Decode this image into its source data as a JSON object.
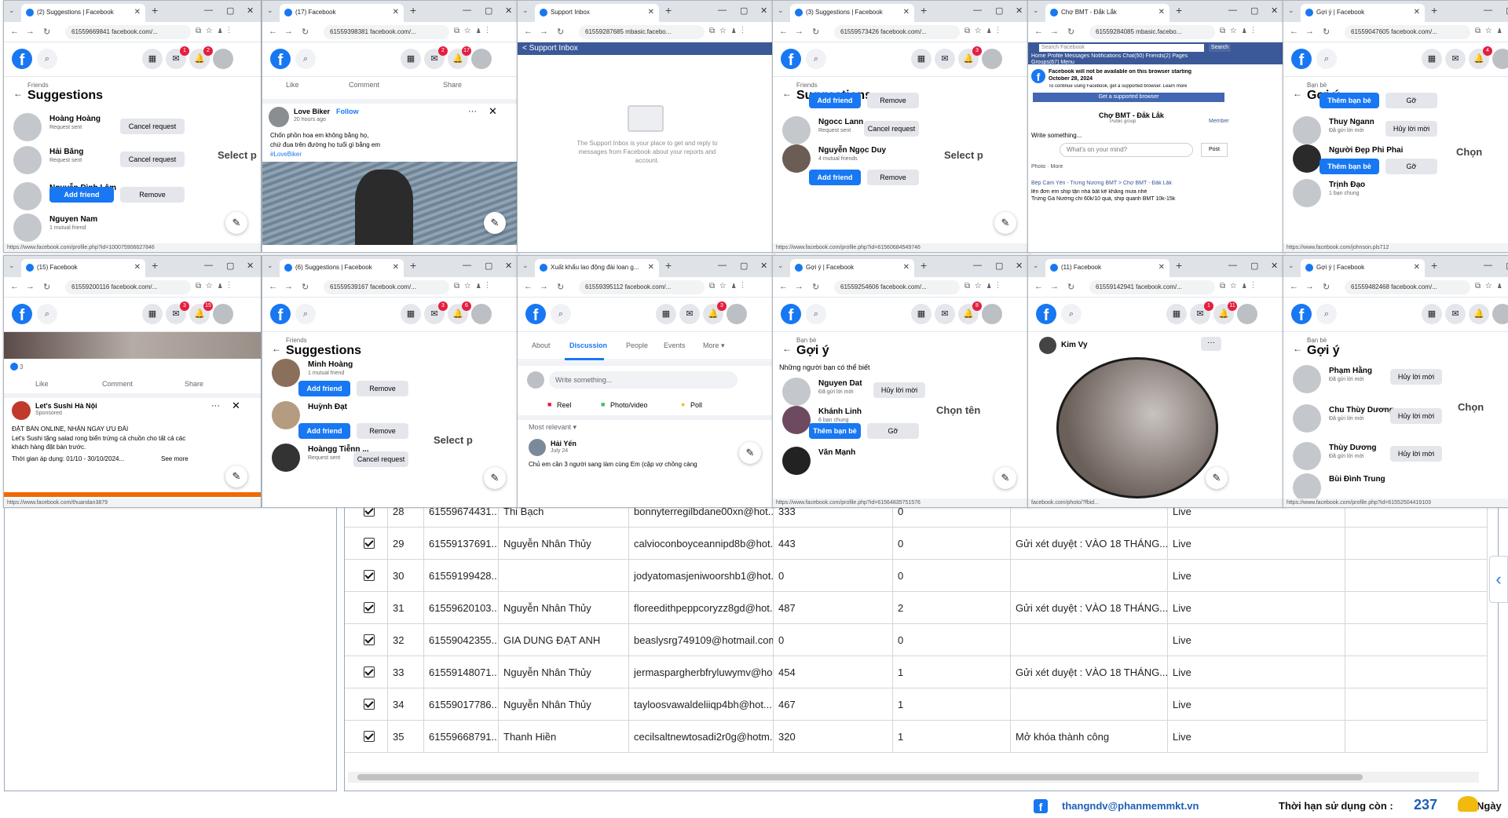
{
  "footer": {
    "email": "thangndv@phanmemmkt.vn",
    "expiry_label": "Thời hạn sử dụng còn :",
    "days": "237",
    "days_label": "Ngày"
  },
  "table": {
    "rows": [
      {
        "n": "28",
        "uid": "61559674431...",
        "name": "Thi Bạch",
        "email": "bonnyterregilbdane00xn@hot...",
        "friends": "333",
        "c": "0",
        "note": "",
        "status": "Live"
      },
      {
        "n": "29",
        "uid": "61559137691...",
        "name": "Nguyễn Nhân Thủy",
        "email": "calvioconboyceannipd8b@hot...",
        "friends": "443",
        "c": "0",
        "note": "Gửi xét duyệt : VÀO 18 THÁNG...",
        "status": "Live"
      },
      {
        "n": "30",
        "uid": "61559199428...",
        "name": "",
        "email": "jodyatomasjeniwoorshb1@hot...",
        "friends": "0",
        "c": "0",
        "note": "",
        "status": "Live"
      },
      {
        "n": "31",
        "uid": "61559620103...",
        "name": "Nguyễn Nhân Thủy",
        "email": "floreedithpeppcoryzz8gd@hot...",
        "friends": "487",
        "c": "2",
        "note": "Gửi xét duyệt : VÀO 18 THÁNG...",
        "status": "Live"
      },
      {
        "n": "32",
        "uid": "61559042355...",
        "name": "GIA DUNG ĐẠT ANH",
        "email": "beaslysrg749109@hotmail.com",
        "friends": "0",
        "c": "0",
        "note": "",
        "status": "Live"
      },
      {
        "n": "33",
        "uid": "61559148071...",
        "name": "Nguyễn Nhân Thủy",
        "email": "jermaspargherbfryluwymv@ho...",
        "friends": "454",
        "c": "1",
        "note": "Gửi xét duyệt : VÀO 18 THÁNG...",
        "status": "Live"
      },
      {
        "n": "34",
        "uid": "61559017786...",
        "name": "Nguyễn Nhân Thủy",
        "email": "tayloosvawaldeliiqp4bh@hot...",
        "friends": "467",
        "c": "1",
        "note": "",
        "status": "Live"
      },
      {
        "n": "35",
        "uid": "61559668791...",
        "name": "Thanh Hiền",
        "email": "cecilsaltnewtosadi2r0g@hotm...",
        "friends": "320",
        "c": "1",
        "note": "Mở khóa thành công",
        "status": "Live"
      }
    ]
  },
  "w1": {
    "tab": "(2) Suggestions | Facebook",
    "url": "61559669841 facebook.com/...",
    "small": "Friends",
    "title": "Suggestions",
    "badges": [
      "1",
      "2"
    ],
    "people": [
      {
        "name": "Hoàng Hoàng",
        "sub": "Request sent",
        "btn": "Cancel request"
      },
      {
        "name": "Hải Băng",
        "sub": "Request sent",
        "btn": "Cancel request"
      },
      {
        "name": "Nguyễn Đình Lâm",
        "sub": "",
        "btn": "Add friend",
        "btn2": "Remove"
      },
      {
        "name": "Nguyen Nam",
        "sub": "1 mutual friend"
      }
    ],
    "side": "Select p",
    "status": "https://www.facebook.com/profile.php?id=100075906627846"
  },
  "w2": {
    "tab": "(17) Facebook",
    "url": "61559398381 facebook.com/...",
    "badges": [
      "2",
      "17"
    ],
    "actions": [
      "Like",
      "Comment",
      "Share"
    ],
    "author": "Love Biker",
    "follow": "Follow",
    "time": "20 hours ago",
    "text1": "Chốn phồn hoa em không bằng họ,",
    "text2": "chứ đua trên đường họ tuổi gì bằng em",
    "tag": "#LoveBiker"
  },
  "w3": {
    "tab": "Support Inbox",
    "url": "61559287685 mbasic.facebo...",
    "header": "< Support Inbox",
    "desc1": "The Support Inbox is your place to get and reply to",
    "desc2": "messages from Facebook about your reports and",
    "desc3": "account."
  },
  "w4": {
    "tab": "(3) Suggestions | Facebook",
    "url": "61559573426 facebook.com/...",
    "small": "Friends",
    "title": "Suggestions",
    "badges": [
      "3"
    ],
    "b1": "Add friend",
    "b1b": "Remove",
    "p1": "Ngocc Lann",
    "p1s": "Request sent",
    "p1b": "Cancel request",
    "p2": "Nguyễn Ngọc Duy",
    "p2s": "4 mutual friends",
    "p2b": "Add friend",
    "p2b2": "Remove",
    "side": "Select p",
    "status": "https://www.facebook.com/profile.php?id=61560684549746"
  },
  "w5": {
    "tab": "Chợ BMT - Đắk Lắk",
    "url": "61559284085 mbasic.facebo...",
    "search": "Search Facebook",
    "search_btn": "Search",
    "nav": "Home  Profile  Messages  Notifications  Chat(50)  Friends(2)  Pages",
    "nav2": "Groups(67)  Menu",
    "warn1": "Facebook will not be available on this browser starting",
    "warn2": "October 28, 2024",
    "warn3": "To continue using Facebook, get a supported browser. Learn more",
    "warn_btn": "Get a supported browser",
    "group": "Chợ BMT - Đắk Lắk",
    "group_sub": "Public group",
    "member": "Member",
    "write": "Write something...",
    "mind": "What's on your mind?",
    "post": "Post",
    "photo": "Photo  ·  More",
    "crumb": "Bếp Cảm Yên - Trưng Nương BMT > Chợ BMT - Đắk Lắk",
    "p1": "lên đơn em ship tận nhà bất kể khẳng mưa nhé",
    "p2": "Trứng Gà Nướng chỉ 60k/10 quả, ship quanh BMT 10k-15k"
  },
  "w6": {
    "tab": "Gợi ý | Facebook",
    "url": "61559047605 facebook.com/...",
    "small": "Bạn bè",
    "title": "Gợi ý",
    "badges": [
      "4"
    ],
    "b1": "Thêm bạn bè",
    "b1b": "Gỡ",
    "p1": "Thuy Ngann",
    "p1s": "Đã gửi lời mời",
    "p1b": "Hủy lời mời",
    "p2": "Người Đẹp Phi Phai",
    "p2b": "Thêm bạn bè",
    "p2b2": "Gỡ",
    "p3": "Trịnh Đạo",
    "p3s": "1 bạn chung",
    "side": "Chọn",
    "status": "https://www.facebook.com/johnson.pls712"
  },
  "w7": {
    "tab": "(15) Facebook",
    "url": "61559200116 facebook.com/...",
    "badges": [
      "3",
      "15"
    ],
    "likes": "3",
    "actions": [
      "Like",
      "Comment",
      "Share"
    ],
    "page": "Let's Sushi Hà Nội",
    "sponsored": "Sponsored",
    "l1": "ĐẶT BÀN ONLINE, NHẬN NGAY ƯU ĐÃI",
    "l2": "Let's Sushi tặng salad rong biển trứng cá chuồn cho tất cả các",
    "l3": "khách hàng đặt bàn trước.",
    "l4": "Thời gian áp dụng: 01/10 - 30/10/2024...",
    "more": "See more",
    "status": "https://www.facebook.com/thuandan3879"
  },
  "w8": {
    "tab": "(6) Suggestions | Facebook",
    "url": "61559539167 facebook.com/...",
    "small": "Friends",
    "title": "Suggestions",
    "badges": [
      "3",
      "6"
    ],
    "p1": "Minh Hoàng",
    "p1s": "1 mutual friend",
    "p1b": "Add friend",
    "p1b2": "Remove",
    "p2": "Huỳnh Đạt",
    "p2b": "Add friend",
    "p2b2": "Remove",
    "p3": "Hoàngg Tiễnn ...",
    "p3s": "Request sent",
    "p3b": "Cancel request",
    "side": "Select p"
  },
  "w9": {
    "tab": "Xuất khẩu lao động đài loan g...",
    "url": "61559395112 facebook.com/...",
    "badges": [
      "3"
    ],
    "tabs": [
      "About",
      "Discussion",
      "People",
      "Events",
      "More ▾"
    ],
    "write": "Write something...",
    "reel": "Reel",
    "photo": "Photo/video",
    "poll": "Poll",
    "sort": "Most relevant ▾",
    "author": "Hải Yến",
    "date": "July 24",
    "snippet": "Chủ em cần 3 người sang làm cùng Em (cặp vợ chồng càng"
  },
  "w10": {
    "tab": "Gợi ý | Facebook",
    "url": "61559254606 facebook.com/...",
    "small": "Bạn bè",
    "title": "Gợi ý",
    "badges": [
      "8"
    ],
    "sub": "Những người bạn có thể biết",
    "p1": "Nguyen Dat",
    "p1s": "Đã gửi lời mời",
    "p1b": "Hủy lời mời",
    "p2": "Khánh Linh",
    "p2s": "6 bạn chung",
    "p2b": "Thêm bạn bè",
    "p2b2": "Gỡ",
    "p3": "Văn Mạnh",
    "side": "Chọn tên",
    "status": "https://www.facebook.com/profile.php?id=61564835751576"
  },
  "w11": {
    "tab": "(11) Facebook",
    "url": "61559142941 facebook.com/...",
    "badges": [
      "1",
      "11"
    ],
    "name": "Kim Vy",
    "status": "facebook.com/photo/?fbid..."
  },
  "w12": {
    "tab": "Gợi ý | Facebook",
    "url": "61559482468 facebook.com/...",
    "small": "Bạn bè",
    "title": "Gợi ý",
    "p1": "Phạm Hằng",
    "p1s": "Đã gửi lời mời",
    "p1b": "Hủy lời mời",
    "p2": "Chu Thùy Dương",
    "p2s": "Đã gửi lời mời",
    "p2b": "Hủy lời mời",
    "p3": "Thùy Dương",
    "p3s": "Đã gửi lời mời",
    "p3b": "Hủy lời mời",
    "p4": "Bùi Đình Trung",
    "side": "Chọn",
    "status": "https://www.facebook.com/profile.php?id=61552504419103"
  },
  "colors": {
    "fb_blue": "#1877f2",
    "mbasic_blue": "#3b5998",
    "badge_red": "#e41e3f"
  }
}
